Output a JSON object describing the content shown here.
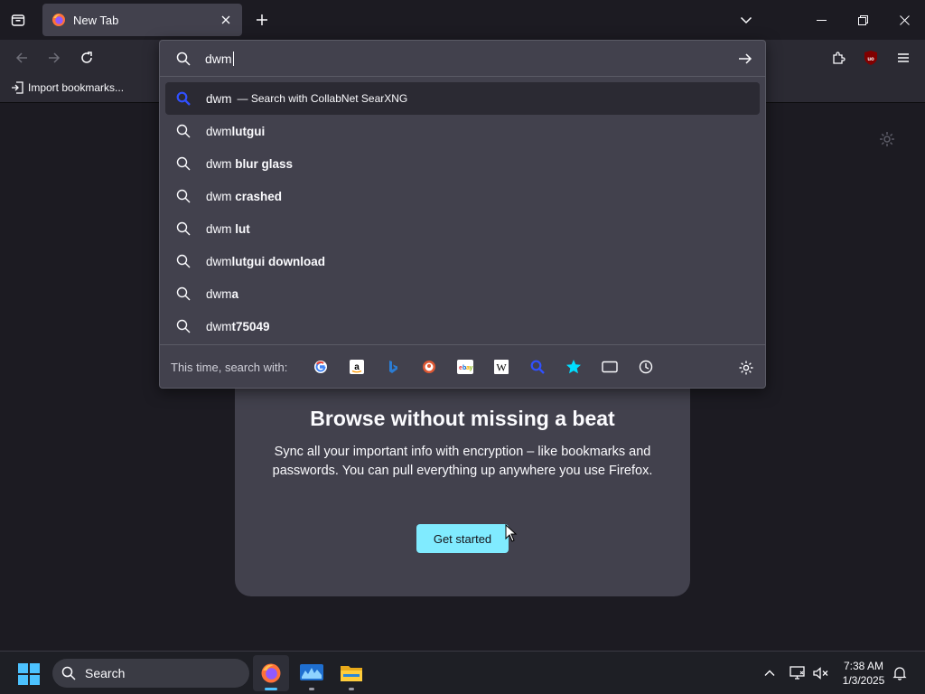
{
  "tabs": [
    {
      "title": "New Tab"
    }
  ],
  "bookmarks": {
    "import_label": "Import bookmarks..."
  },
  "urlbar": {
    "query": "dwm",
    "results": [
      {
        "prefix": "dwm",
        "suffix": "",
        "action": "— Search with CollabNet SearXNG",
        "selected": true
      },
      {
        "prefix": "dwm",
        "suffix": "lutgui"
      },
      {
        "prefix": "dwm ",
        "suffix": "blur glass"
      },
      {
        "prefix": "dwm ",
        "suffix": "crashed"
      },
      {
        "prefix": "dwm ",
        "suffix": "lut"
      },
      {
        "prefix": "dwm",
        "suffix": "lutgui download"
      },
      {
        "prefix": "dwm",
        "suffix": "a"
      },
      {
        "prefix": "dwm",
        "suffix": "t75049"
      }
    ],
    "oneoff_label": "This time, search with:",
    "engines": [
      "google-icon",
      "amazon-icon",
      "bing-icon",
      "duckduckgo-icon",
      "ebay-icon",
      "wikipedia-icon",
      "searxng-icon",
      "bookmarks-star-icon",
      "tabs-icon",
      "history-icon"
    ]
  },
  "promo": {
    "title": "Browse without missing a beat",
    "body": "Sync all your important info with encryption – like bookmarks and passwords. You can pull everything up anywhere you use Firefox.",
    "button": "Get started"
  },
  "taskbar": {
    "search_placeholder": "Search",
    "time": "7:38 AM",
    "date": "1/3/2025"
  },
  "colors": {
    "accent": "#80ebff",
    "searxng": "#3050ff"
  }
}
